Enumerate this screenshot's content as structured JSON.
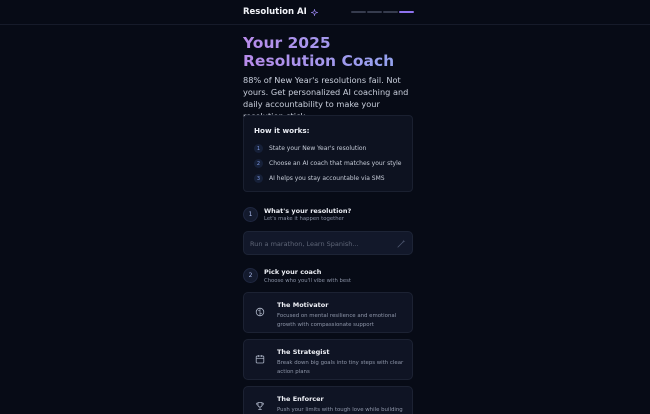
{
  "header": {
    "brand": "Resolution AI",
    "brand_icon": "sparkle-icon",
    "progress_steps": 4,
    "progress_current": 4,
    "accent_color": "#8e72ee"
  },
  "hero": {
    "title": "Your 2025 Resolution Coach",
    "subtitle": "88% of New Year's resolutions fail. Not yours. Get personalized AI coaching and daily accountability to make your resolution stick."
  },
  "how_it_works": {
    "title": "How it works:",
    "steps": [
      {
        "num": "1",
        "text": "State your New Year's resolution"
      },
      {
        "num": "2",
        "text": "Choose an AI coach that matches your style"
      },
      {
        "num": "3",
        "text": "AI helps you stay accountable via SMS"
      }
    ]
  },
  "section1": {
    "num": "1",
    "title": "What's your resolution?",
    "subtitle": "Let's make it happen together",
    "input_placeholder": "Run a marathon, Learn Spanish...",
    "input_value": ""
  },
  "section2": {
    "num": "2",
    "title": "Pick your coach",
    "subtitle": "Choose who you'll vibe with best"
  },
  "coaches": [
    {
      "name": "The Motivator",
      "icon": "brain-icon",
      "description": "Focused on mental resilience and emotional growth with compassionate support"
    },
    {
      "name": "The Strategist",
      "icon": "calendar-icon",
      "description": "Break down big goals into tiny steps with clear action plans"
    },
    {
      "name": "The Enforcer",
      "icon": "trophy-icon",
      "description": "Push your limits with tough love while building"
    }
  ]
}
